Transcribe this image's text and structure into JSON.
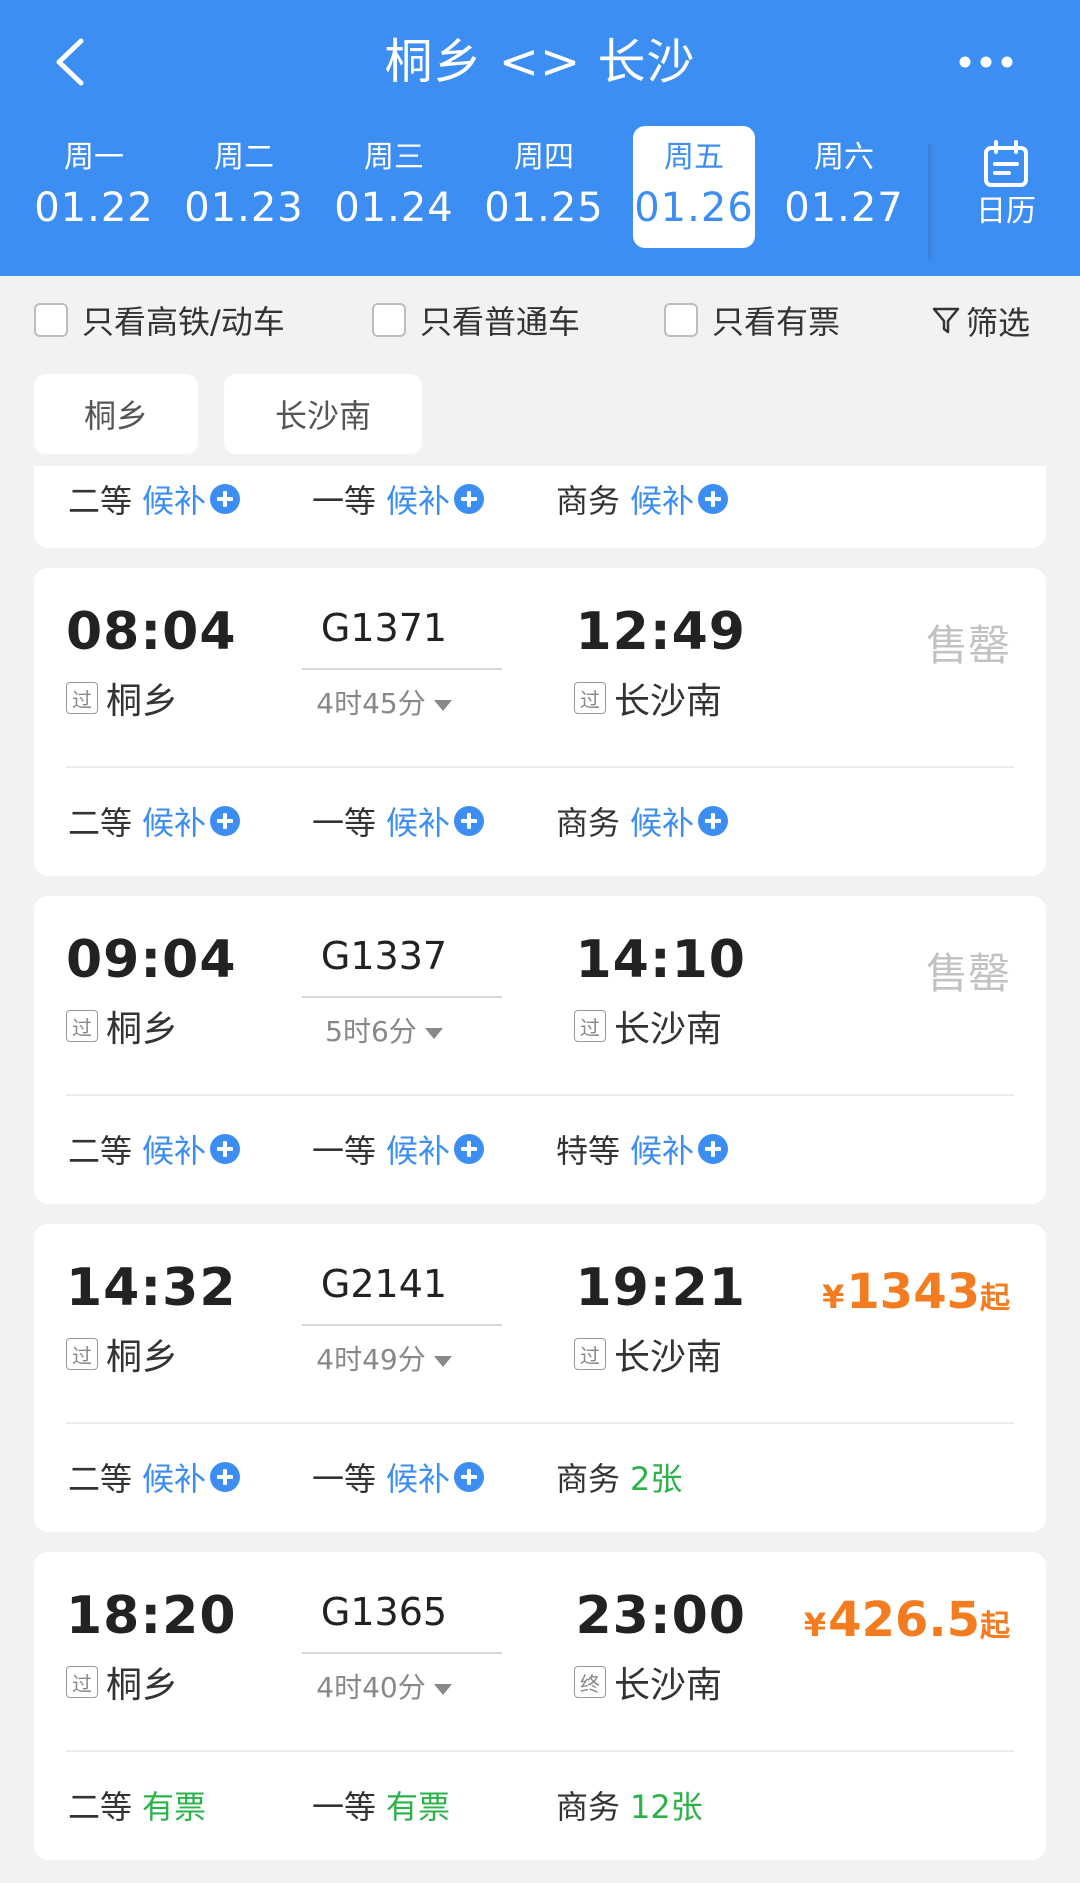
{
  "header": {
    "title": "桐乡 <> 长沙",
    "back_icon": "back-chevron-icon",
    "more_icon": "more-dots-icon",
    "calendar_label": "日历",
    "colors": {
      "primary": "#3d8ef2",
      "accent_orange": "#f47c20",
      "green": "#2bb34a"
    }
  },
  "dates": [
    {
      "dow": "周一",
      "date": "01.22"
    },
    {
      "dow": "周二",
      "date": "01.23"
    },
    {
      "dow": "周三",
      "date": "01.24"
    },
    {
      "dow": "周四",
      "date": "01.25"
    },
    {
      "dow": "周五",
      "date": "01.26"
    },
    {
      "dow": "周六",
      "date": "01.27"
    }
  ],
  "filters": {
    "high_speed": "只看高铁/动车",
    "normal": "只看普通车",
    "available": "只看有票",
    "filter_btn": "筛选"
  },
  "stations": {
    "from": "桐乡",
    "to": "长沙南"
  },
  "partial_card": {
    "seats": [
      {
        "cls": "二等",
        "status": "候补"
      },
      {
        "cls": "一等",
        "status": "候补"
      },
      {
        "cls": "商务",
        "status": "候补"
      }
    ]
  },
  "trains": [
    {
      "dep": "08:04",
      "arr": "12:49",
      "no": "G1371",
      "duration": "4时45分",
      "from": "桐乡",
      "to": "长沙南",
      "from_tag": "过",
      "to_tag": "过",
      "status": "售罄",
      "price": "",
      "price_yen": "",
      "price_from": "",
      "seats": [
        {
          "cls": "二等",
          "status": "候补"
        },
        {
          "cls": "一等",
          "status": "候补"
        },
        {
          "cls": "商务",
          "status": "候补"
        }
      ]
    },
    {
      "dep": "09:04",
      "arr": "14:10",
      "no": "G1337",
      "duration": "5时6分",
      "from": "桐乡",
      "to": "长沙南",
      "from_tag": "过",
      "to_tag": "过",
      "status": "售罄",
      "price": "",
      "price_yen": "",
      "price_from": "",
      "seats": [
        {
          "cls": "二等",
          "status": "候补"
        },
        {
          "cls": "一等",
          "status": "候补"
        },
        {
          "cls": "特等",
          "status": "候补"
        }
      ]
    },
    {
      "dep": "14:32",
      "arr": "19:21",
      "no": "G2141",
      "duration": "4时49分",
      "from": "桐乡",
      "to": "长沙南",
      "from_tag": "过",
      "to_tag": "过",
      "status": "",
      "price": "1343",
      "price_yen": "¥",
      "price_from": "起",
      "seats": [
        {
          "cls": "二等",
          "status": "候补"
        },
        {
          "cls": "一等",
          "status": "候补"
        },
        {
          "cls": "商务",
          "status": "2张"
        }
      ]
    },
    {
      "dep": "18:20",
      "arr": "23:00",
      "no": "G1365",
      "duration": "4时40分",
      "from": "桐乡",
      "to": "长沙南",
      "from_tag": "过",
      "to_tag": "终",
      "status": "",
      "price": "426.5",
      "price_yen": "¥",
      "price_from": "起",
      "seats": [
        {
          "cls": "二等",
          "status": "有票"
        },
        {
          "cls": "一等",
          "status": "有票"
        },
        {
          "cls": "商务",
          "status": "12张"
        }
      ]
    }
  ]
}
